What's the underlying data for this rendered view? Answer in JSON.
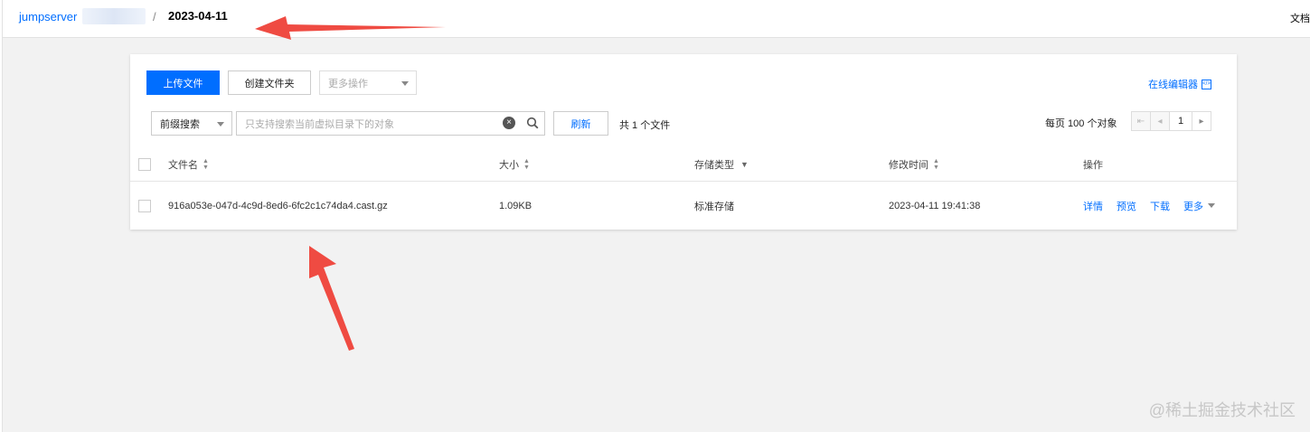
{
  "breadcrumb": {
    "root": "jumpserver",
    "separator": "/",
    "current": "2023-04-11"
  },
  "header_right_text": "文档",
  "toolbar": {
    "upload_label": "上传文件",
    "create_folder_label": "创建文件夹",
    "more_actions_label": "更多操作",
    "online_editor_label": "在线编辑器"
  },
  "search": {
    "mode": "前缀搜索",
    "placeholder": "只支持搜索当前虚拟目录下的对象",
    "refresh_label": "刷新",
    "file_count": "共 1 个文件"
  },
  "pagination": {
    "per_page_label": "每页 100 个对象",
    "current_page": "1"
  },
  "table": {
    "headers": {
      "name": "文件名",
      "size": "大小",
      "storage": "存储类型",
      "modified": "修改时间",
      "actions": "操作"
    },
    "rows": [
      {
        "name": "916a053e-047d-4c9d-8ed6-6fc2c1c74da4.cast.gz",
        "size": "1.09KB",
        "storage": "标准存储",
        "modified": "2023-04-11 19:41:38",
        "actions": [
          "详情",
          "预览",
          "下载",
          "更多"
        ]
      }
    ]
  },
  "watermark": "@稀土掘金技术社区",
  "colors": {
    "accent": "#006eff",
    "annotation_arrow": "#ef4b42"
  }
}
